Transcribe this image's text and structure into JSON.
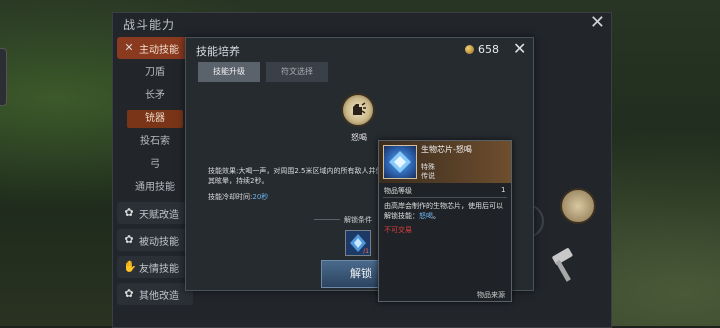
{
  "outer_panel": {
    "title": "战斗能力",
    "close_icon": "✕"
  },
  "sidebar": {
    "active_category": {
      "label": "主动技能",
      "icon": "x-icon"
    },
    "sub_items": [
      "刀盾",
      "长矛",
      "铳器",
      "投石索",
      "弓",
      "通用技能"
    ],
    "selected_sub": "铳器",
    "categories": [
      {
        "label": "天赋改造",
        "icon": "gear-icon"
      },
      {
        "label": "被动技能",
        "icon": "gear-icon"
      },
      {
        "label": "友情技能",
        "icon": "handshake-icon"
      },
      {
        "label": "其他改造",
        "icon": "gear-icon"
      }
    ]
  },
  "dialog": {
    "title": "技能培养",
    "currency": {
      "value": "658",
      "icon": "coin-icon"
    },
    "close_icon": "✕",
    "tabs": [
      {
        "label": "技能升级",
        "active": true
      },
      {
        "label": "符文选择",
        "active": false
      }
    ],
    "skill": {
      "name": "怒喝",
      "effect": "技能效果:大喝一声，对周围2.5米区域内的所有敌人并使其眩晕，持续2秒。",
      "cooldown_label": "技能冷却时间:",
      "cooldown_value": "20秒"
    },
    "unlock_conditions_label": "解锁条件",
    "chip_count": "/1",
    "unlock_button": "解锁"
  },
  "tooltip": {
    "name": "生物芯片-怒喝",
    "type": "特殊",
    "rarity": "传说",
    "level_label": "物品等级",
    "level_value": "1",
    "description": "由高岸会制作的生物芯片，使用后可以解锁技能：",
    "description_highlight": "怒喝",
    "description_end": "。",
    "not_tradable": "不可交易",
    "source_link": "物品来源"
  },
  "colors": {
    "accent_active": "#8a3a1e",
    "highlight_blue": "#6fb6f0",
    "warning_red": "#e0403a"
  }
}
